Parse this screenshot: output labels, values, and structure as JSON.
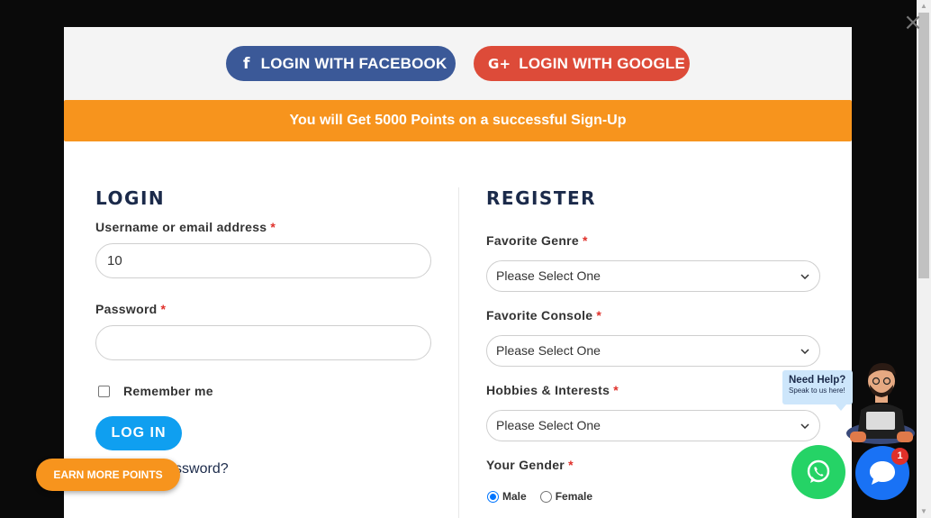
{
  "modal": {
    "close_glyph": "×",
    "social": {
      "facebook_label": "LOGIN WITH FACEBOOK",
      "facebook_icon": "f",
      "google_label": "LOGIN WITH GOOGLE",
      "google_icon": "G+"
    },
    "banner": "You will Get 5000 Points on a successful Sign-Up"
  },
  "login": {
    "title": "LOGIN",
    "username_label": "Username or email address",
    "username_value": "10",
    "password_label": "Password",
    "password_value": "",
    "required_mark": "*",
    "remember_label": "Remember me",
    "submit_label": "LOG IN",
    "lost_password_label": "Lost your password?"
  },
  "register": {
    "title": "REGISTER",
    "required_mark": "*",
    "fields": [
      {
        "label": "Favorite Genre",
        "value": "Please Select One"
      },
      {
        "label": "Favorite Console",
        "value": "Please Select One"
      },
      {
        "label": "Hobbies & Interests",
        "value": "Please Select One"
      }
    ],
    "gender_label": "Your Gender",
    "gender_options": [
      "Male",
      "Female"
    ],
    "gender_selected": "Male"
  },
  "widgets": {
    "earn_points_label": "EARN MORE POINTS",
    "help_title": "Need Help?",
    "help_subtitle": "Speak to us here!",
    "chat_badge_count": "1"
  },
  "colors": {
    "facebook": "#3b5998",
    "google": "#dd4b39",
    "banner": "#f7941d",
    "login_button": "#0f9ff0",
    "whatsapp": "#25d366",
    "chat": "#1972f5",
    "required": "#e0302a"
  }
}
